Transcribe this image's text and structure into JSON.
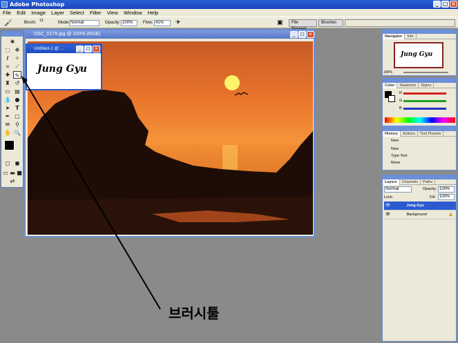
{
  "app": {
    "title": "Adobe Photoshop",
    "window_buttons": [
      "_",
      "□",
      "×"
    ]
  },
  "menu": [
    "File",
    "Edit",
    "Image",
    "Layer",
    "Select",
    "Filter",
    "View",
    "Window",
    "Help"
  ],
  "options_bar": {
    "brush_label": "Brush:",
    "brush_size": "13",
    "mode_label": "Mode:",
    "mode_value": "Normal",
    "opacity_label": "Opacity:",
    "opacity_value": "100%",
    "flow_label": "Flow:",
    "flow_value": "41%",
    "tab_file_browser": "File Browser",
    "tab_brushes": "Brushes"
  },
  "document": {
    "title": "DSC_0179.jpg @ 100% (RGB)"
  },
  "untitled_doc": {
    "title": "Untitled-1 @ ...",
    "signature": "Jung Gyu"
  },
  "navigator": {
    "tabs": [
      "Navigator",
      "Info"
    ],
    "thumb_text": "Jung Gyu",
    "zoom": "100%"
  },
  "color_palette": {
    "tabs": [
      "Color",
      "Swatches",
      "Styles"
    ],
    "channels": [
      "R",
      "G",
      "B"
    ],
    "colors": {
      "r": "#d02020",
      "g": "#20a020",
      "b": "#2030c0"
    }
  },
  "history": {
    "tabs": [
      "History",
      "Actions",
      "Tool Presets"
    ],
    "snapshot": "New",
    "items": [
      "New",
      "Type Tool",
      "Move"
    ]
  },
  "layers": {
    "tabs": [
      "Layers",
      "Channels",
      "Paths"
    ],
    "blend_mode": "Normal",
    "opacity_label": "Opacity:",
    "opacity_value": "100%",
    "lock_label": "Lock:",
    "fill_label": "Fill:",
    "fill_value": "100%",
    "items": [
      {
        "name": "Jung Gyu",
        "selected": true
      },
      {
        "name": "Background",
        "selected": false
      }
    ]
  },
  "annotation": {
    "label": "브러시툴"
  }
}
